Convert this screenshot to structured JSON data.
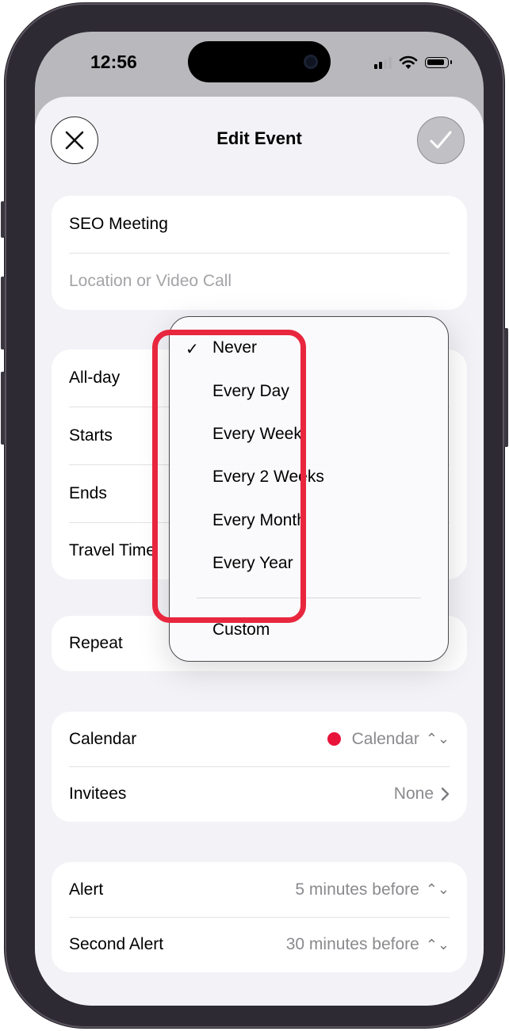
{
  "status_bar": {
    "time": "12:56"
  },
  "header": {
    "title": "Edit Event"
  },
  "event": {
    "title_value": "SEO Meeting",
    "location_placeholder": "Location or Video Call"
  },
  "date_rows": {
    "all_day_label": "All-day",
    "starts_label": "Starts",
    "ends_label": "Ends",
    "travel_time_label": "Travel Time"
  },
  "repeat": {
    "label": "Repeat"
  },
  "repeat_menu": {
    "selected": "Never",
    "items": [
      "Never",
      "Every Day",
      "Every Week",
      "Every 2 Weeks",
      "Every Month",
      "Every Year",
      "Custom"
    ]
  },
  "calendar_section": {
    "calendar_label": "Calendar",
    "calendar_value": "Calendar",
    "calendar_color": "#e8143a",
    "invitees_label": "Invitees",
    "invitees_value": "None"
  },
  "alerts": {
    "alert_label": "Alert",
    "alert_value": "5 minutes before",
    "second_alert_label": "Second Alert",
    "second_alert_value": "30 minutes before"
  },
  "colors": {
    "highlight": "#e8273f",
    "background": "#f2f2f7"
  }
}
